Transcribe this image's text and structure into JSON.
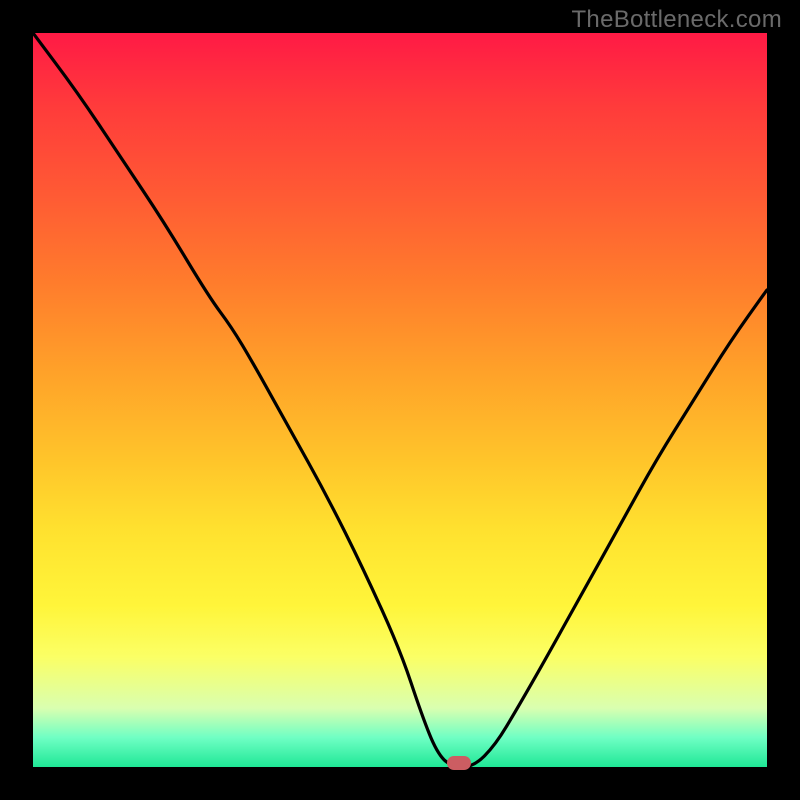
{
  "watermark": "TheBottleneck.com",
  "chart_data": {
    "type": "line",
    "title": "",
    "xlabel": "",
    "ylabel": "",
    "xlim": [
      0,
      100
    ],
    "ylim": [
      0,
      100
    ],
    "series": [
      {
        "name": "bottleneck-curve",
        "x": [
          0,
          6,
          12,
          18,
          24,
          27,
          30,
          35,
          40,
          45,
          50,
          53,
          55,
          57,
          60,
          63,
          66,
          70,
          75,
          80,
          85,
          90,
          95,
          100
        ],
        "y": [
          100,
          92,
          83,
          74,
          64,
          60,
          55,
          46,
          37,
          27,
          16,
          7,
          2,
          0,
          0,
          3,
          8,
          15,
          24,
          33,
          42,
          50,
          58,
          65
        ]
      }
    ],
    "marker": {
      "x": 58,
      "y": 0.5
    },
    "background_gradient": {
      "top": "#ff1a45",
      "mid": "#ffe22f",
      "bottom": "#1fe796"
    }
  }
}
